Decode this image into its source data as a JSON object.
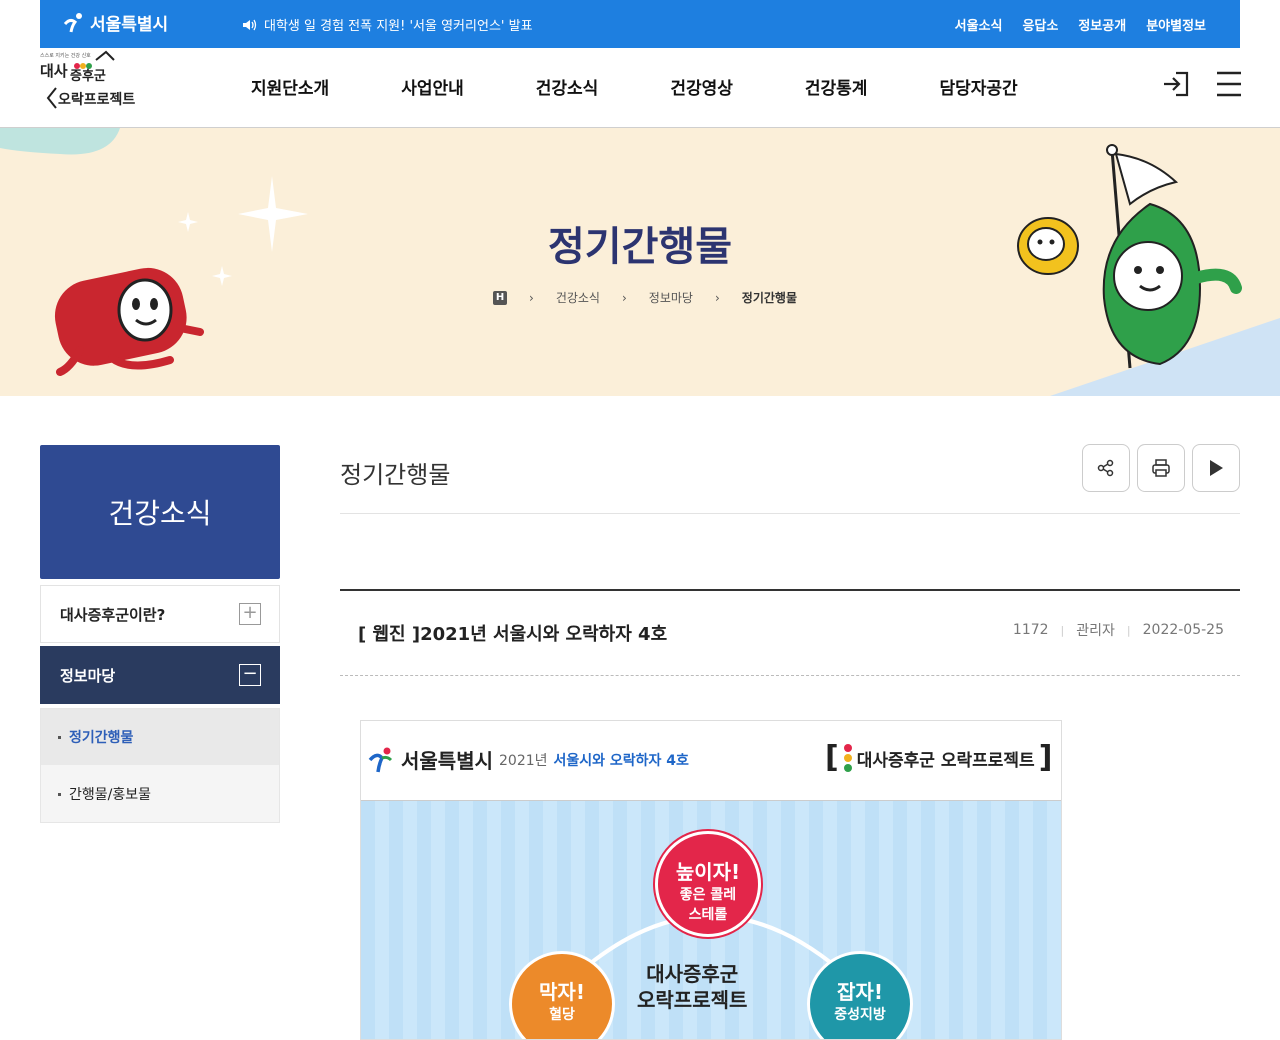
{
  "topbar": {
    "seoul_logo": "서울특별시",
    "notice": "대학생 일 경험 전폭 지원! '서울 영커리언스' 발표",
    "links": [
      "서울소식",
      "응답소",
      "정보공개",
      "분야별정보"
    ]
  },
  "gnb": {
    "menu": [
      "지원단소개",
      "사업안내",
      "건강소식",
      "건강영상",
      "건강통계",
      "담당자공간"
    ]
  },
  "banner": {
    "title": "정기간행물",
    "breadcrumb": [
      "건강소식",
      "정보마당",
      "정기간행물"
    ]
  },
  "lnb": {
    "title": "건강소식",
    "items": [
      {
        "label": "대사증후군이란?",
        "state": "collapsed"
      },
      {
        "label": "정보마당",
        "state": "expanded"
      }
    ],
    "subitems": [
      "정기간행물",
      "간행물/홍보물"
    ]
  },
  "content": {
    "title": "정기간행물",
    "post": {
      "title": "[ 웹진 ]2021년 서울시와 오락하자 4호",
      "views": "1172",
      "author": "관리자",
      "date": "2022-05-25"
    }
  },
  "webzine": {
    "seoul": "서울특별시",
    "year": "2021년",
    "issue": "서울시와 오락하자 4호",
    "project": "대사증후군 오락프로젝트",
    "circles": [
      {
        "big": "높이자!",
        "small1": "좋은 콜레",
        "small2": "스테롤"
      },
      {
        "big": "막자!",
        "small1": "혈당",
        "small2": ""
      },
      {
        "big": "잡자!",
        "small1": "중성지방",
        "small2": ""
      }
    ],
    "center_line1": "대사증후군",
    "center_line2": "오락프로젝트"
  },
  "icons": [
    "speaker-icon",
    "login-icon",
    "hamburger-icon",
    "home-icon",
    "share-icon",
    "print-icon",
    "play-icon",
    "plus-icon",
    "minus-icon"
  ],
  "colors": {
    "topbar": "#1e7fe0",
    "banner_bg": "#fbefd9",
    "lnb_title": "#2f4a92",
    "lnb_active": "#2a3b5f",
    "title_text": "#2c3470"
  }
}
